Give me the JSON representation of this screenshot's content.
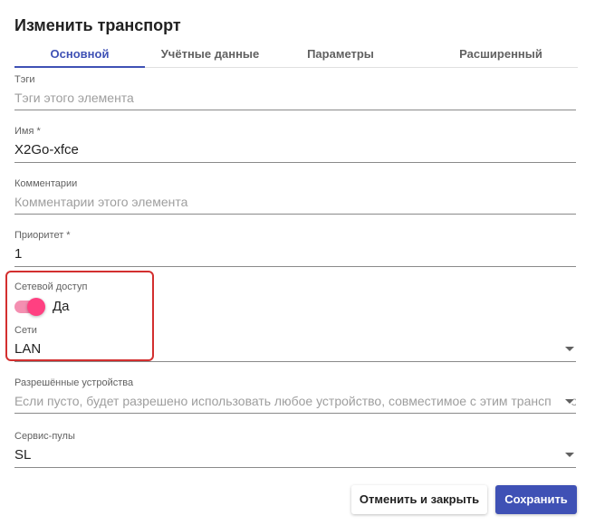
{
  "dialog": {
    "title": "Изменить транспорт"
  },
  "tabs": [
    {
      "label": "Основной",
      "active": true
    },
    {
      "label": "Учётные данные",
      "active": false
    },
    {
      "label": "Параметры",
      "active": false
    },
    {
      "label": "Расширенный",
      "active": false
    }
  ],
  "fields": {
    "tags": {
      "label": "Тэги",
      "placeholder": "Тэги этого элемента"
    },
    "name": {
      "label": "Имя *",
      "value": "X2Go-xfce"
    },
    "comments": {
      "label": "Комментарии",
      "placeholder": "Комментарии этого элемента"
    },
    "priority": {
      "label": "Приоритет *",
      "value": "1"
    },
    "network_access": {
      "label": "Сетевой доступ",
      "toggle_text": "Да",
      "enabled": true
    },
    "networks": {
      "label": "Сети",
      "value": "LAN"
    },
    "allowed_devices": {
      "label": "Разрешённые устройства",
      "placeholder": "Если пусто, будет разрешено использовать любое устройство, совместимое с этим транспортом"
    },
    "service_pools": {
      "label": "Сервис-пулы",
      "value": "SL"
    }
  },
  "buttons": {
    "cancel": "Отменить и закрыть",
    "save": "Сохранить"
  },
  "colors": {
    "accent": "#3f51b5",
    "toggle": "#ff4081",
    "highlight": "#d32f2f"
  }
}
